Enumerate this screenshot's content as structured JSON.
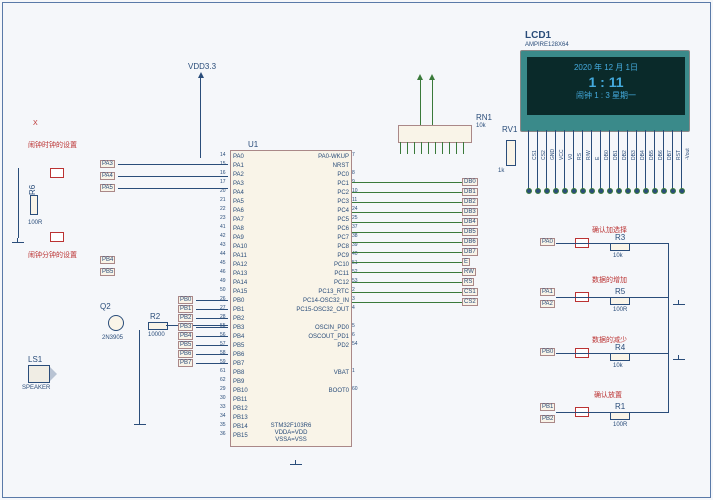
{
  "title_vdd": "VDD3.3",
  "lcd": {
    "ref": "LCD1",
    "part": "AMPIRE128X64",
    "line1": "2020 年 12 月 1日",
    "line2": "1 : 11",
    "line3": "闹钟 1 : 3   星期一",
    "pins": [
      "CS1",
      "CS2",
      "GND",
      "VCC",
      "V0",
      "RS",
      "R/W",
      "E",
      "DB0",
      "DB1",
      "DB2",
      "DB3",
      "DB4",
      "DB5",
      "DB6",
      "DB7",
      "RST",
      "-Vout"
    ]
  },
  "u1": {
    "ref": "U1",
    "part": "STM32F103R6",
    "power": "VDDA=VDD\nVSSA=VSS",
    "left_pins": [
      "PA0",
      "PA1",
      "PA2",
      "PA3",
      "PA4",
      "PA5",
      "PA6",
      "PA7",
      "PA8",
      "PA9",
      "PA10",
      "PA11",
      "PA12",
      "PA13",
      "PA14",
      "PA15",
      "PB0",
      "PB1",
      "PB2",
      "PB3",
      "PB4",
      "PB5",
      "PB6",
      "PB7",
      "PB8",
      "PB9",
      "PB10",
      "PB11",
      "PB12",
      "PB13",
      "PB14",
      "PB15"
    ],
    "right_pins": [
      "PA0-WKUP",
      "NRST",
      "PC0",
      "PC1",
      "PC2",
      "PC3",
      "PC4",
      "PC5",
      "PC6",
      "PC7",
      "PC8",
      "PC9",
      "PC10",
      "PC11",
      "PC12",
      "PC13_RTC",
      "PC14-OSC32_IN",
      "PC15-OSC32_OUT",
      "",
      "OSCIN_PD0",
      "OSCOUT_PD1",
      "PD2",
      "",
      "",
      "VBAT",
      "",
      "BOOT0"
    ],
    "left_nums": [
      "14",
      "15",
      "16",
      "17",
      "20",
      "21",
      "22",
      "23",
      "41",
      "42",
      "43",
      "44",
      "45",
      "46",
      "49",
      "50",
      "26",
      "27",
      "28",
      "55",
      "56",
      "57",
      "58",
      "59",
      "61",
      "62",
      "29",
      "30",
      "33",
      "34",
      "35",
      "36"
    ],
    "right_nums": [
      "7",
      "",
      "8",
      "9",
      "10",
      "11",
      "24",
      "25",
      "37",
      "38",
      "39",
      "40",
      "51",
      "52",
      "53",
      "2",
      "3",
      "4",
      "",
      "5",
      "6",
      "54",
      "",
      "",
      "1",
      "",
      "60"
    ]
  },
  "rn1": {
    "ref": "RN1",
    "val": "10k"
  },
  "rv1": {
    "ref": "RV1",
    "val": "1k"
  },
  "r1": {
    "ref": "R1",
    "val": "100R"
  },
  "r2": {
    "ref": "R2",
    "val": "10000"
  },
  "r3": {
    "ref": "R3",
    "val": "10k"
  },
  "r4": {
    "ref": "R4",
    "val": "10k"
  },
  "r5": {
    "ref": "R5",
    "val": "100R"
  },
  "r6": {
    "ref": "R6",
    "val": "100R"
  },
  "q2": {
    "ref": "Q2",
    "part": "2N3905"
  },
  "ls1": {
    "ref": "LS1",
    "part": "SPEAKER"
  },
  "labels": {
    "x": "X",
    "hour_set": "闹钟时钟的设置",
    "min_set": "闹钟分钟的设置",
    "confirm_sel": "确认加选择",
    "data_inc": "数据的增加",
    "data_dec": "数据的减少",
    "confirm_set": "确认放置"
  },
  "nets": {
    "pa0": "PA0",
    "pa1": "PA1",
    "pa2": "PA2",
    "pa3": "PA3",
    "pa4": "PA4",
    "pa5": "PA5",
    "pb0": "PB0",
    "pb1": "PB1",
    "pb2": "PB2",
    "pb3": "PB3",
    "pb4": "PB4",
    "pb5": "PB5",
    "db": [
      "DB0",
      "DB1",
      "DB2",
      "DB3",
      "DB4",
      "DB5",
      "DB6",
      "DB7"
    ],
    "ctrl": [
      "E",
      "RW",
      "RS",
      "CS1",
      "CS2"
    ]
  }
}
